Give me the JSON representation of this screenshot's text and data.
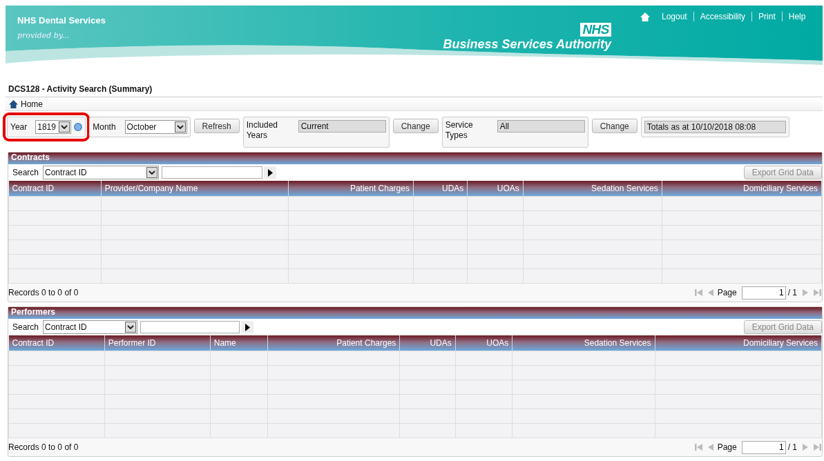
{
  "header": {
    "service": "NHS Dental Services",
    "tagline": "provided by...",
    "logo": "NHS",
    "authority": "Business Services Authority",
    "links": [
      "Logout",
      "Accessibility",
      "Print",
      "Help"
    ]
  },
  "page_title": "DCS128 - Activity Search (Summary)",
  "breadcrumb": "Home",
  "filters": {
    "year": {
      "label": "Year",
      "value": "1819",
      "highlighted": true
    },
    "month": {
      "label": "Month",
      "value": "October"
    },
    "refresh": "Refresh",
    "included_years": {
      "label": "Included Years",
      "value": "Current",
      "button": "Change"
    },
    "service_types": {
      "label": "Service Types",
      "value": "All",
      "button": "Change"
    },
    "totals": "Totals as at 10/10/2018 08:08"
  },
  "grids": [
    {
      "title": "Contracts",
      "search_label": "Search",
      "search_by": "Contract ID",
      "export": "Export Grid Data",
      "columns": [
        "Contract ID",
        "Provider/Company Name",
        "Patient Charges",
        "UDAs",
        "UOAs",
        "Sedation Services",
        "Domiciliary Services"
      ],
      "records": "Records 0 to 0 of 0",
      "page_label": "Page",
      "page": "1",
      "pages": "/ 1"
    },
    {
      "title": "Performers",
      "search_label": "Search",
      "search_by": "Contract ID",
      "export": "Export Grid Data",
      "columns": [
        "Contract ID",
        "Performer ID",
        "Name",
        "Patient Charges",
        "UDAs",
        "UOAs",
        "Sedation Services",
        "Domiciliary Services"
      ],
      "records": "Records 0 to 0 of 0",
      "page_label": "Page",
      "page": "1",
      "pages": "/ 1"
    }
  ]
}
